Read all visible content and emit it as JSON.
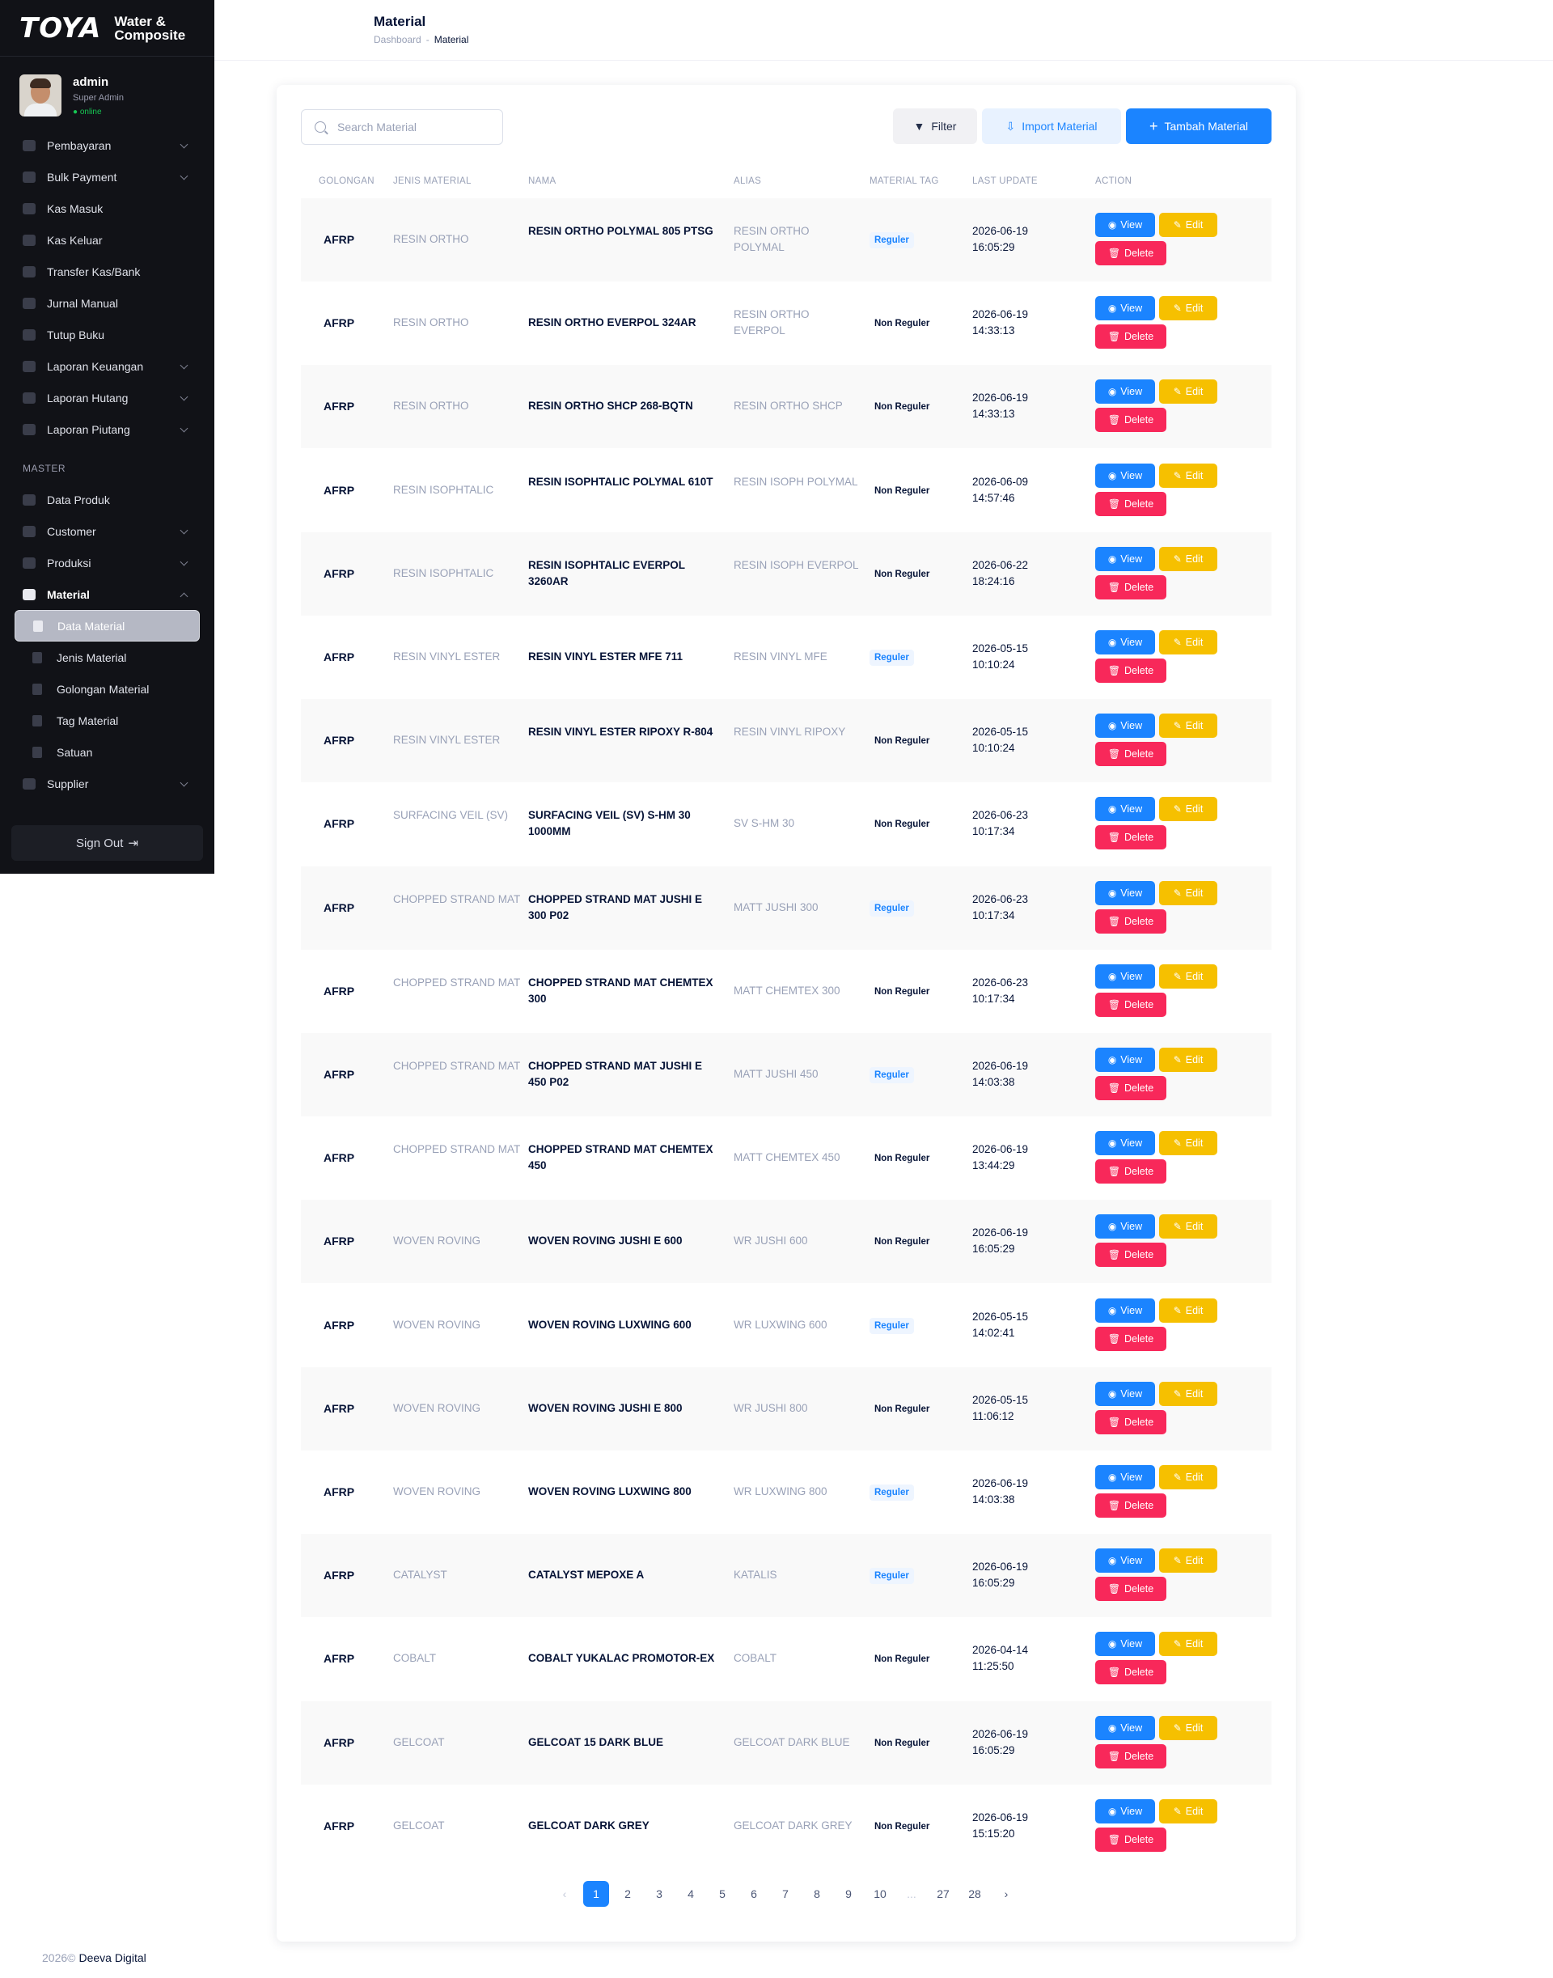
{
  "brand": {
    "logo": "TOYA",
    "subtitle_1": "Water &",
    "subtitle_2": "Composite"
  },
  "user": {
    "name": "admin",
    "role": "Super Admin",
    "status": "● online"
  },
  "menu": {
    "items": [
      {
        "label": "Pembayaran",
        "chevron": true
      },
      {
        "label": "Bulk Payment",
        "chevron": true
      },
      {
        "label": "Kas Masuk",
        "chevron": false
      },
      {
        "label": "Kas Keluar",
        "chevron": false
      },
      {
        "label": "Transfer Kas/Bank",
        "chevron": false
      },
      {
        "label": "Jurnal Manual",
        "chevron": false
      },
      {
        "label": "Tutup Buku",
        "chevron": false
      },
      {
        "label": "Laporan Keuangan",
        "chevron": true
      },
      {
        "label": "Laporan Hutang",
        "chevron": true
      },
      {
        "label": "Laporan Piutang",
        "chevron": true
      }
    ],
    "section_master": "MASTER",
    "master_items": [
      {
        "label": "Data Produk"
      },
      {
        "label": "Customer"
      },
      {
        "label": "Produksi"
      },
      {
        "label": "Material"
      }
    ],
    "material_sub": [
      {
        "label": "Data Material"
      },
      {
        "label": "Jenis Material"
      },
      {
        "label": "Golongan Material"
      },
      {
        "label": "Tag Material"
      },
      {
        "label": "Satuan"
      }
    ],
    "supplier": "Supplier",
    "signout": "Sign Out"
  },
  "header": {
    "title": "Material",
    "breadcrumb": [
      "Dashboard",
      "Material"
    ]
  },
  "toolbar": {
    "search_placeholder": "Search Material",
    "filter_label": "Filter",
    "import_label": "Import Material",
    "add_label": "Tambah Material"
  },
  "table": {
    "columns": [
      "GOLONGAN",
      "JENIS MATERIAL",
      "NAMA",
      "ALIAS",
      "MATERIAL TAG",
      "LAST UPDATE",
      "ACTION"
    ],
    "action_labels": {
      "view": "View",
      "edit": "Edit",
      "delete": "Delete"
    },
    "rows": [
      {
        "golongan": "AFRP",
        "jenis": "RESIN ORTHO",
        "nama": "RESIN ORTHO POLYMAL 805 PTSG",
        "alias": "RESIN ORTHO POLYMAL",
        "tag": "Reguler",
        "date": "2026-06-19",
        "time": "16:05:29"
      },
      {
        "golongan": "AFRP",
        "jenis": "RESIN ORTHO",
        "nama": "RESIN ORTHO EVERPOL 324AR",
        "alias": "RESIN ORTHO EVERPOL",
        "tag": "Non Reguler",
        "date": "2026-06-19",
        "time": "14:33:13"
      },
      {
        "golongan": "AFRP",
        "jenis": "RESIN ORTHO",
        "nama": "RESIN ORTHO SHCP 268-BQTN",
        "alias": "RESIN ORTHO SHCP",
        "tag": "Non Reguler",
        "date": "2026-06-19",
        "time": "14:33:13"
      },
      {
        "golongan": "AFRP",
        "jenis": "RESIN ISOPHTALIC",
        "nama": "RESIN ISOPHTALIC POLYMAL 610T",
        "alias": "RESIN ISOPH POLYMAL",
        "tag": "Non Reguler",
        "date": "2026-06-09",
        "time": "14:57:46"
      },
      {
        "golongan": "AFRP",
        "jenis": "RESIN ISOPHTALIC",
        "nama": "RESIN ISOPHTALIC EVERPOL 3260AR",
        "alias": "RESIN ISOPH EVERPOL",
        "tag": "Non Reguler",
        "date": "2026-06-22",
        "time": "18:24:16"
      },
      {
        "golongan": "AFRP",
        "jenis": "RESIN VINYL ESTER",
        "nama": "RESIN VINYL ESTER MFE 711",
        "alias": "RESIN VINYL MFE",
        "tag": "Reguler",
        "date": "2026-05-15",
        "time": "10:10:24"
      },
      {
        "golongan": "AFRP",
        "jenis": "RESIN VINYL ESTER",
        "nama": "RESIN VINYL ESTER RIPOXY R-804",
        "alias": "RESIN VINYL RIPOXY",
        "tag": "Non Reguler",
        "date": "2026-05-15",
        "time": "10:10:24"
      },
      {
        "golongan": "AFRP",
        "jenis": "SURFACING VEIL (SV)",
        "nama": "SURFACING VEIL (SV) S-HM 30 1000MM",
        "alias": "SV S-HM 30",
        "tag": "Non Reguler",
        "date": "2026-06-23",
        "time": "10:17:34"
      },
      {
        "golongan": "AFRP",
        "jenis": "CHOPPED STRAND MAT",
        "nama": "CHOPPED STRAND MAT JUSHI E 300 P02",
        "alias": "MATT JUSHI 300",
        "tag": "Reguler",
        "date": "2026-06-23",
        "time": "10:17:34"
      },
      {
        "golongan": "AFRP",
        "jenis": "CHOPPED STRAND MAT",
        "nama": "CHOPPED STRAND MAT CHEMTEX 300",
        "alias": "MATT CHEMTEX 300",
        "tag": "Non Reguler",
        "date": "2026-06-23",
        "time": "10:17:34"
      },
      {
        "golongan": "AFRP",
        "jenis": "CHOPPED STRAND MAT",
        "nama": "CHOPPED STRAND MAT JUSHI E 450 P02",
        "alias": "MATT JUSHI 450",
        "tag": "Reguler",
        "date": "2026-06-19",
        "time": "14:03:38"
      },
      {
        "golongan": "AFRP",
        "jenis": "CHOPPED STRAND MAT",
        "nama": "CHOPPED STRAND MAT CHEMTEX 450",
        "alias": "MATT CHEMTEX 450",
        "tag": "Non Reguler",
        "date": "2026-06-19",
        "time": "13:44:29"
      },
      {
        "golongan": "AFRP",
        "jenis": "WOVEN ROVING",
        "nama": "WOVEN ROVING JUSHI E 600",
        "alias": "WR JUSHI 600",
        "tag": "Non Reguler",
        "date": "2026-06-19",
        "time": "16:05:29"
      },
      {
        "golongan": "AFRP",
        "jenis": "WOVEN ROVING",
        "nama": "WOVEN ROVING LUXWING 600",
        "alias": "WR LUXWING 600",
        "tag": "Reguler",
        "date": "2026-05-15",
        "time": "14:02:41"
      },
      {
        "golongan": "AFRP",
        "jenis": "WOVEN ROVING",
        "nama": "WOVEN ROVING JUSHI E 800",
        "alias": "WR JUSHI 800",
        "tag": "Non Reguler",
        "date": "2026-05-15",
        "time": "11:06:12"
      },
      {
        "golongan": "AFRP",
        "jenis": "WOVEN ROVING",
        "nama": "WOVEN ROVING LUXWING 800",
        "alias": "WR LUXWING 800",
        "tag": "Reguler",
        "date": "2026-06-19",
        "time": "14:03:38"
      },
      {
        "golongan": "AFRP",
        "jenis": "CATALYST",
        "nama": "CATALYST MEPOXE A",
        "alias": "KATALIS",
        "tag": "Reguler",
        "date": "2026-06-19",
        "time": "16:05:29"
      },
      {
        "golongan": "AFRP",
        "jenis": "COBALT",
        "nama": "COBALT YUKALAC PROMOTOR-EX",
        "alias": "COBALT",
        "tag": "Non Reguler",
        "date": "2026-04-14",
        "time": "11:25:50"
      },
      {
        "golongan": "AFRP",
        "jenis": "GELCOAT",
        "nama": "GELCOAT 15 DARK BLUE",
        "alias": "GELCOAT DARK BLUE",
        "tag": "Non Reguler",
        "date": "2026-06-19",
        "time": "16:05:29"
      },
      {
        "golongan": "AFRP",
        "jenis": "GELCOAT",
        "nama": "GELCOAT DARK GREY",
        "alias": "GELCOAT DARK GREY",
        "tag": "Non Reguler",
        "date": "2026-06-19",
        "time": "15:15:20"
      }
    ]
  },
  "pagination": {
    "prev": "‹",
    "pages": [
      "1",
      "2",
      "3",
      "4",
      "5",
      "6",
      "7",
      "8",
      "9",
      "10",
      "...",
      "27",
      "28"
    ],
    "next": "›",
    "current": "1"
  },
  "footer": {
    "year": "2026©",
    "company": "Deeva Digital"
  },
  "colors": {
    "primary": "#1b84ff",
    "warning": "#f6c000",
    "danger": "#f8285a",
    "sidebar": "#111217"
  }
}
